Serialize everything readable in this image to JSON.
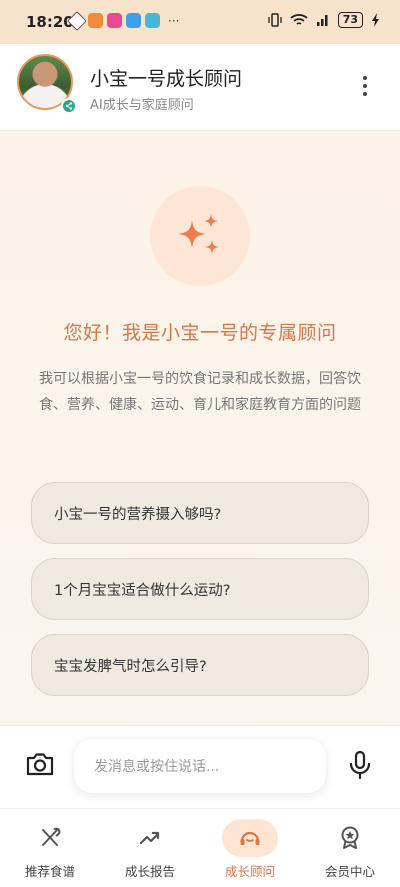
{
  "status_bar": {
    "time": "18:20",
    "battery": "73",
    "more_indicator": "···"
  },
  "header": {
    "title": "小宝一号成长顾问",
    "subtitle": "AI成长与家庭顾问",
    "avatar_badge_icon": "share-icon"
  },
  "hero": {
    "icon": "sparkle-icon",
    "title": "您好！我是小宝一号的专属顾问",
    "description": "我可以根据小宝一号的饮食记录和成长数据，回答饮食、营养、健康、运动、育儿和家庭教育方面的问题"
  },
  "suggestions": [
    {
      "label": "小宝一号的营养摄入够吗?"
    },
    {
      "label": "1个月宝宝适合做什么运动?"
    },
    {
      "label": "宝宝发脾气时怎么引导?"
    }
  ],
  "input": {
    "placeholder": "发消息或按住说话..."
  },
  "nav": [
    {
      "label": "推荐食谱",
      "icon": "utensils-icon",
      "active": false
    },
    {
      "label": "成长报告",
      "icon": "trend-chart-icon",
      "active": false
    },
    {
      "label": "成长顾问",
      "icon": "advisor-icon",
      "active": true
    },
    {
      "label": "会员中心",
      "icon": "member-badge-icon",
      "active": false
    }
  ],
  "colors": {
    "accent": "#d9774a",
    "accent_light": "#fde4d3",
    "suggestion_bg": "#efe9e0"
  }
}
